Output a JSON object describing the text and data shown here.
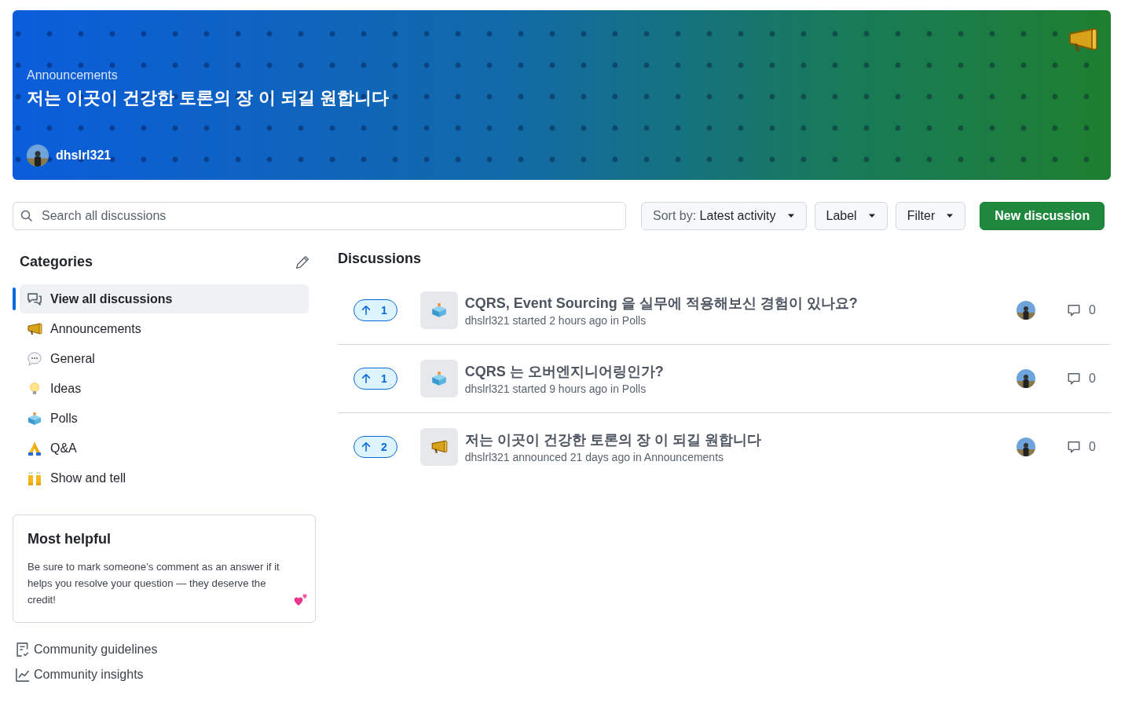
{
  "banner": {
    "category": "Announcements",
    "title": "저는 이곳이 건강한 토론의 장 이 되길 원합니다",
    "author": "dhslrl321"
  },
  "search": {
    "placeholder": "Search all discussions"
  },
  "sort_button": "Sort by: **Latest activity**",
  "label_button": "Label",
  "filter_button": "Filter",
  "new_button": "New discussion",
  "categories": {
    "title": "Categories",
    "items": [
      {
        "label": "View all discussions",
        "kind": "discussions",
        "selected": true
      },
      {
        "label": "Announcements",
        "kind": "megaphone",
        "selected": false
      },
      {
        "label": "General",
        "kind": "speech",
        "selected": false
      },
      {
        "label": "Ideas",
        "kind": "bulb",
        "selected": false
      },
      {
        "label": "Polls",
        "kind": "ballot",
        "selected": false
      },
      {
        "label": "Q&A",
        "kind": "pray",
        "selected": false
      },
      {
        "label": "Show and tell",
        "kind": "hands",
        "selected": false
      }
    ]
  },
  "helpful": {
    "title": "Most helpful",
    "text": "Be sure to mark someone’s comment as an answer if it helps you resolve your question — they deserve the credit!"
  },
  "links": [
    {
      "label": "Community guidelines",
      "kind": "guidelines"
    },
    {
      "label": "Community insights",
      "kind": "insights"
    }
  ],
  "discussions": {
    "title": "Discussions",
    "items": [
      {
        "votes": "1",
        "kind": "ballot",
        "title": "CQRS, Event Sourcing 을 실무에 적용해보신 경험이 있나요?",
        "meta": "dhslrl321 started 2 hours ago in Polls",
        "comments": "0"
      },
      {
        "votes": "1",
        "kind": "ballot",
        "title": "CQRS 는 오버엔지니어링인가?",
        "meta": "dhslrl321 started 9 hours ago in Polls",
        "comments": "0"
      },
      {
        "votes": "2",
        "kind": "megaphone",
        "title": "저는 이곳이 건강한 토론의 장 이 되길 원합니다",
        "meta": "dhslrl321 announced 21 days ago in Announcements",
        "comments": "0"
      }
    ]
  }
}
